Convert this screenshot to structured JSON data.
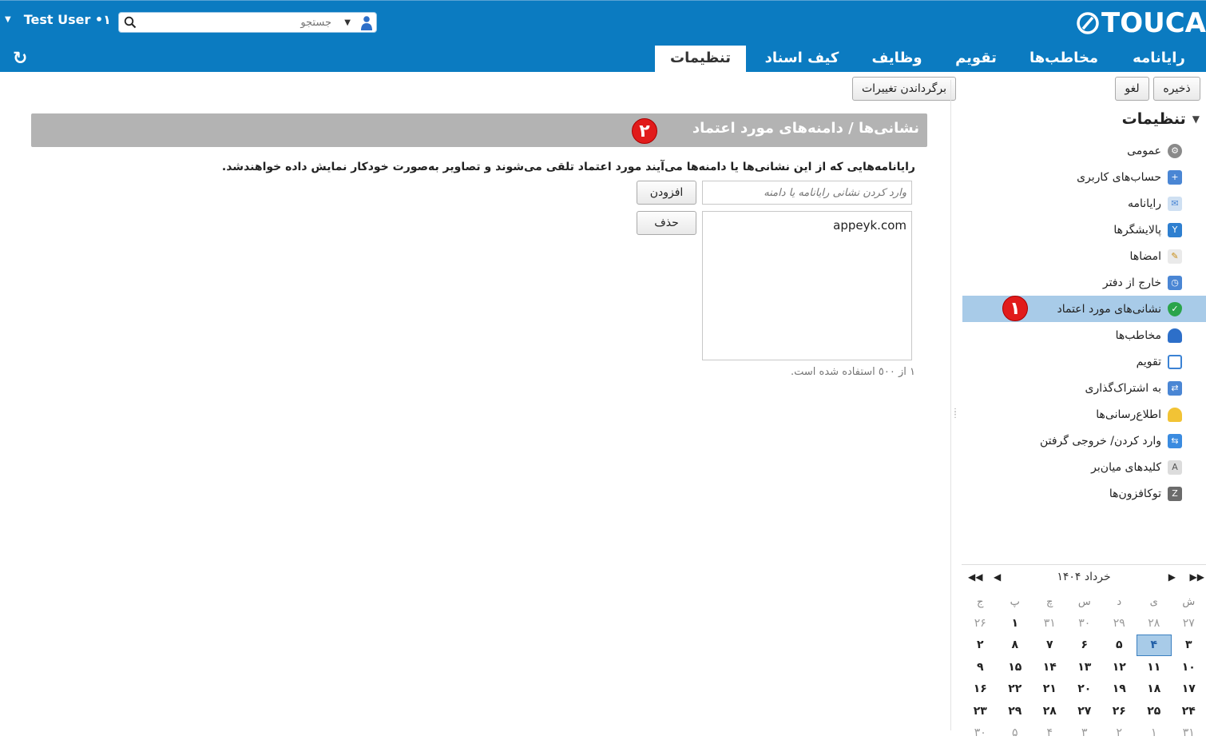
{
  "app": {
    "logo_text": "TOUCA"
  },
  "user": {
    "name": "Test User •١"
  },
  "search": {
    "placeholder": "جستجو"
  },
  "tabs": [
    {
      "label": "رایانامه"
    },
    {
      "label": "مخاطب‌ها"
    },
    {
      "label": "تقویم"
    },
    {
      "label": "وظایف"
    },
    {
      "label": "کیف اسناد"
    },
    {
      "label": "تنظیمات",
      "active": true
    }
  ],
  "toolbar": {
    "save": "ذخیره",
    "cancel": "لغو",
    "revert": "برگرداندن تغییرات"
  },
  "sidebar": {
    "title": "تنظیمات",
    "items": [
      {
        "label": "عمومی",
        "icon": "gear-icon"
      },
      {
        "label": "حساب‌های کاربری",
        "icon": "accounts-icon"
      },
      {
        "label": "رایانامه",
        "icon": "mail-icon"
      },
      {
        "label": "پالایشگرها",
        "icon": "filter-icon"
      },
      {
        "label": "امضاها",
        "icon": "signature-icon"
      },
      {
        "label": "خارج از دفتر",
        "icon": "out-of-office-icon"
      },
      {
        "label": "نشانی‌های مورد اعتماد",
        "icon": "trusted-shield-icon",
        "active": true
      },
      {
        "label": "مخاطب‌ها",
        "icon": "contact-icon"
      },
      {
        "label": "تقویم",
        "icon": "calendar-icon"
      },
      {
        "label": "به اشتراک‌گذاری",
        "icon": "sharing-icon"
      },
      {
        "label": "اطلاع‌رسانی‌ها",
        "icon": "bell-icon"
      },
      {
        "label": "وارد کردن/ خروجی گرفتن",
        "icon": "import-export-icon"
      },
      {
        "label": "کلیدهای میان‌بر",
        "icon": "keyboard-shortcut-icon"
      },
      {
        "label": "توکافزون‌ها",
        "icon": "zimlet-icon"
      }
    ]
  },
  "badges": {
    "one": "١",
    "two": "٢"
  },
  "panel": {
    "title": "نشانی‌ها / دامنه‌های مورد اعتماد",
    "description": "رایانامه‌هایی که از این نشانی‌ها یا دامنه‌ها می‌آیند مورد اعتماد تلقی می‌شوند و تصاویر به‌صورت خودکار نمایش داده خواهندشد.",
    "input_placeholder": "وارد کردن نشانی رایانامه یا دامنه",
    "add_button": "افزودن",
    "delete_button": "حذف",
    "entries": [
      "appeyk.com"
    ],
    "usage": "١ از ٥٠٠ استفاده شده است."
  },
  "calendar": {
    "month_label": "۱۴۰۴ خرداد",
    "weekdays": [
      "ش",
      "ی",
      "د",
      "س",
      "چ",
      "پ",
      "ج"
    ],
    "weeks": [
      [
        {
          "d": "۲۷",
          "o": true
        },
        {
          "d": "۲۸",
          "o": true
        },
        {
          "d": "۲۹",
          "o": true
        },
        {
          "d": "۳۰",
          "o": true
        },
        {
          "d": "۳۱",
          "o": true
        },
        {
          "d": "۱"
        },
        {
          "d": "۲۶",
          "o": true
        }
      ],
      [
        {
          "d": "۳"
        },
        {
          "d": "۴",
          "t": true
        },
        {
          "d": "۵"
        },
        {
          "d": "۶"
        },
        {
          "d": "۷"
        },
        {
          "d": "۸"
        },
        {
          "d": "۲"
        }
      ],
      [
        {
          "d": "۱۰"
        },
        {
          "d": "۱۱"
        },
        {
          "d": "۱۲"
        },
        {
          "d": "۱۳"
        },
        {
          "d": "۱۴"
        },
        {
          "d": "۱۵"
        },
        {
          "d": "۹"
        }
      ],
      [
        {
          "d": "۱۷"
        },
        {
          "d": "۱۸"
        },
        {
          "d": "۱۹"
        },
        {
          "d": "۲۰"
        },
        {
          "d": "۲۱"
        },
        {
          "d": "۲۲"
        },
        {
          "d": "۱۶"
        }
      ],
      [
        {
          "d": "۲۴"
        },
        {
          "d": "۲۵"
        },
        {
          "d": "۲۶"
        },
        {
          "d": "۲۷"
        },
        {
          "d": "۲۸"
        },
        {
          "d": "۲۹"
        },
        {
          "d": "۲۳"
        }
      ],
      [
        {
          "d": "۳۱",
          "o": true
        },
        {
          "d": "۱",
          "o": true
        },
        {
          "d": "۲",
          "o": true
        },
        {
          "d": "۳",
          "o": true
        },
        {
          "d": "۴",
          "o": true
        },
        {
          "d": "۵",
          "o": true
        },
        {
          "d": "۳۰",
          "o": true
        }
      ]
    ]
  },
  "colors": {
    "brand": "#0b7bc1",
    "selection": "#a8cbe8",
    "badge": "#e11b1b",
    "header_gray": "#b3b3b3"
  }
}
